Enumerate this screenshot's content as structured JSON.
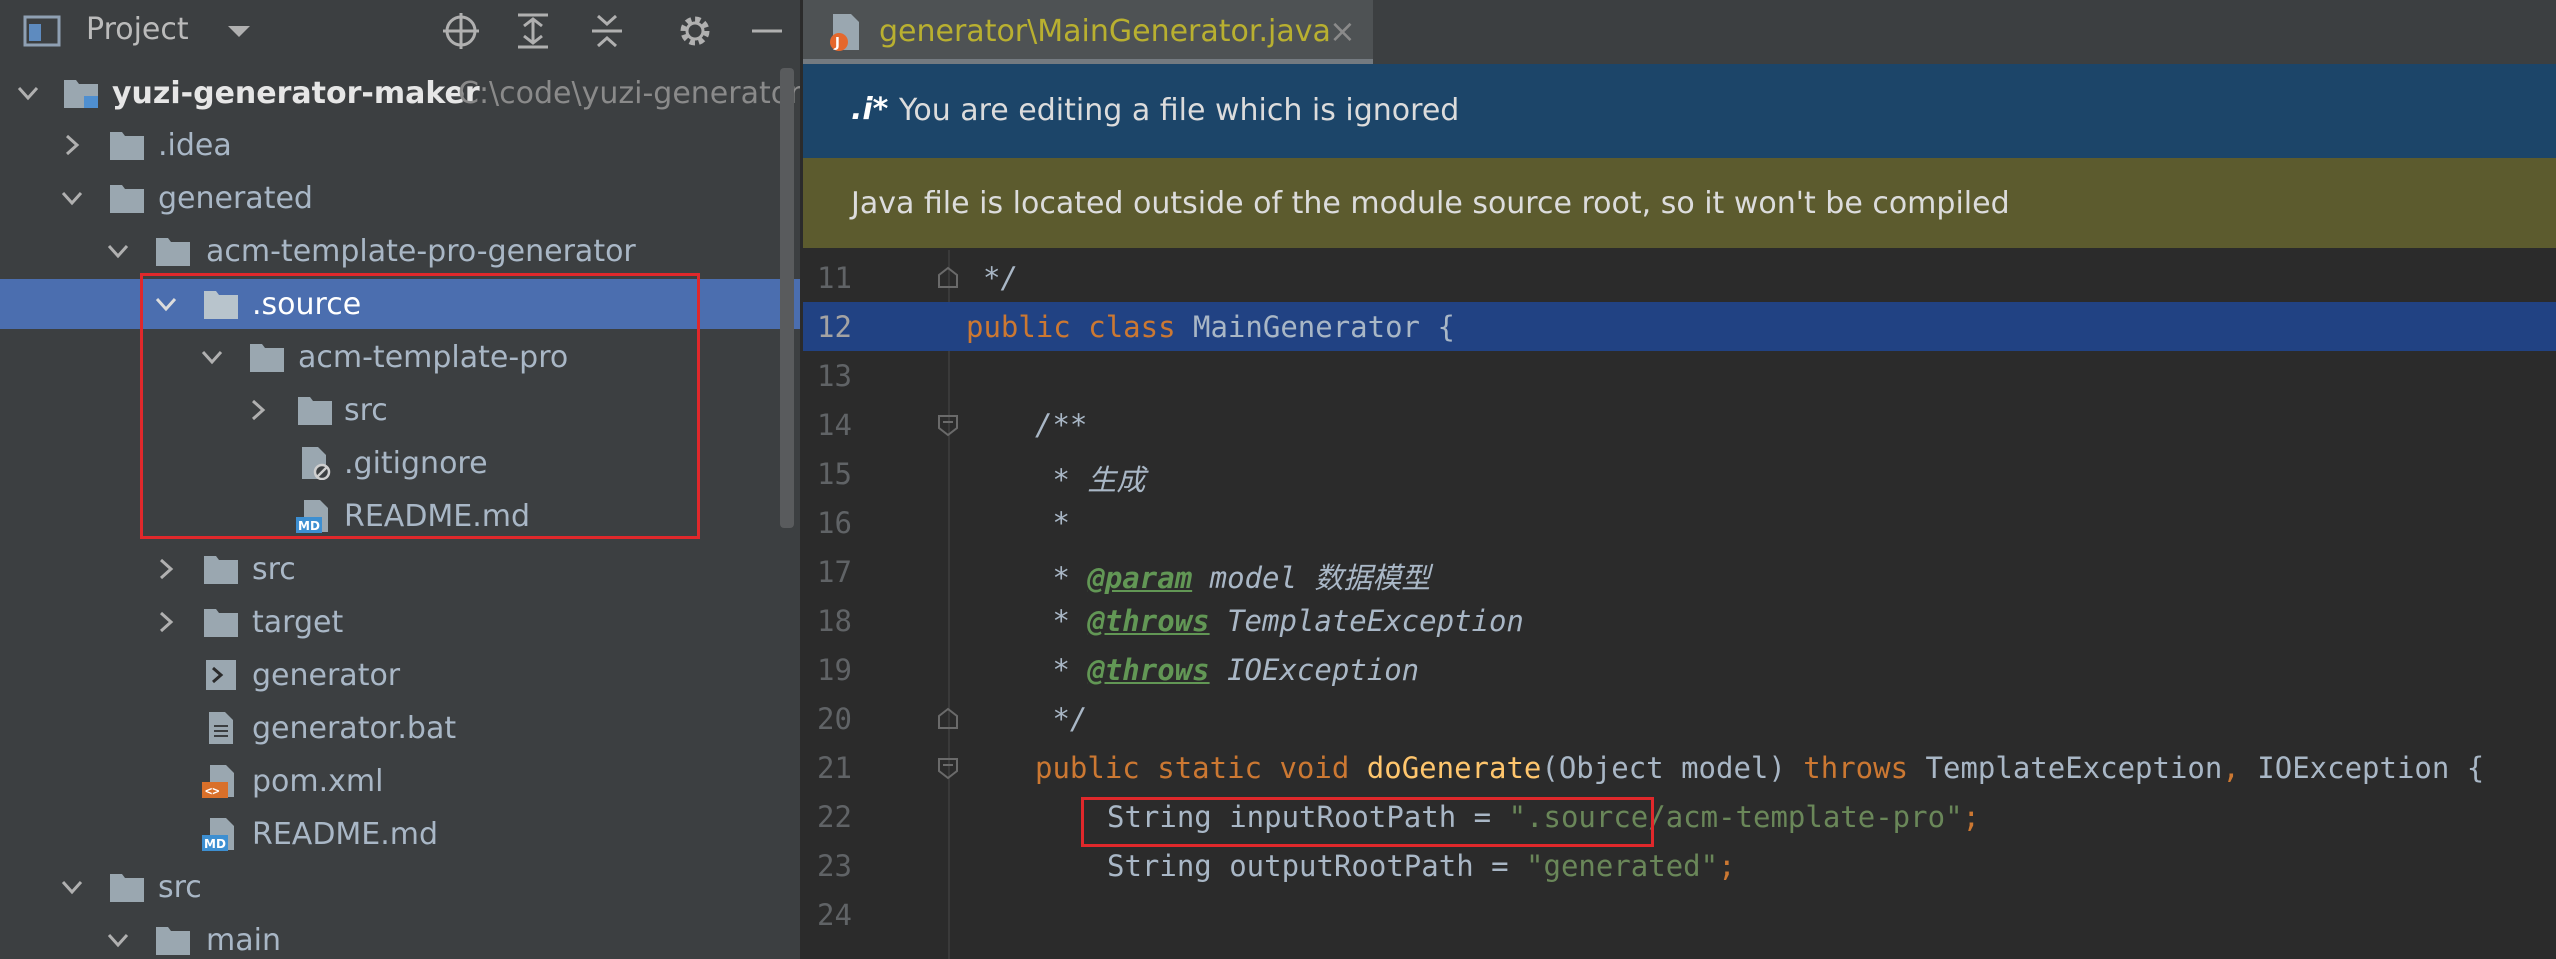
{
  "project_panel": {
    "title": "Project",
    "tree": [
      {
        "label": "yuzi-generator-maker",
        "path": "C:\\code\\yuzi-generator\\"
      },
      {
        "label": ".idea"
      },
      {
        "label": "generated"
      },
      {
        "label": "acm-template-pro-generator"
      },
      {
        "label": ".source"
      },
      {
        "label": "acm-template-pro"
      },
      {
        "label": "src"
      },
      {
        "label": ".gitignore"
      },
      {
        "label": "README.md"
      },
      {
        "label": "src"
      },
      {
        "label": "target"
      },
      {
        "label": "generator"
      },
      {
        "label": "generator.bat"
      },
      {
        "label": "pom.xml"
      },
      {
        "label": "README.md"
      },
      {
        "label": "src"
      },
      {
        "label": "main"
      }
    ]
  },
  "editor": {
    "tab_label": "generator\\MainGenerator.java",
    "tab_close": "×",
    "banner_ignored": {
      "icon_text": ".i*",
      "text": "You are editing a file which is ignored"
    },
    "banner_outside": {
      "text": "Java file is located outside of the module source root, so it won't be compiled"
    },
    "lines": {
      "n11": "11",
      "n12": "12",
      "n13": "13",
      "n14": "14",
      "n15": "15",
      "n16": "16",
      "n17": "17",
      "n18": "18",
      "n19": "19",
      "n20": "20",
      "n21": "21",
      "n22": "22",
      "n23": "23",
      "n24": "24",
      "l11": "*/",
      "l12_kw1": "public",
      "l12_kw2": "class",
      "l12_rest": "MainGenerator {",
      "l14": "/**",
      "l15": " * 生成",
      "l16": " *",
      "l17_a": " * ",
      "l17_tag": "@param",
      "l17_b": " model 数据模型",
      "l18_a": " * ",
      "l18_tag": "@throws",
      "l18_b": " TemplateException",
      "l19_a": " * ",
      "l19_tag": "@throws",
      "l19_b": " IOException",
      "l20": " */",
      "l21_kw1": "public",
      "l21_kw2": "static",
      "l21_kw3": "void",
      "l21_fn": "doGenerate",
      "l21_mid": "(Object model) ",
      "l21_kw4": "throws",
      "l21_t1": " TemplateException",
      "l21_comma": ",",
      "l21_t2": " IOException {",
      "l22_a": "String inputRootPath = ",
      "l22_str": "\".source/acm-template-pro\"",
      "l22_semi": ";",
      "l23_a": "String outputRootPath = ",
      "l23_str": "\"generated\"",
      "l23_semi": ";"
    }
  },
  "colors": {
    "panel_bg": "#3c3f41",
    "editor_bg": "#2b2b2b",
    "selection": "#4b6eaf",
    "current_line": "#214283",
    "highlight_box": "#e0282b",
    "banner_blue": "#1c4569",
    "banner_olive": "#5c5b2e"
  }
}
